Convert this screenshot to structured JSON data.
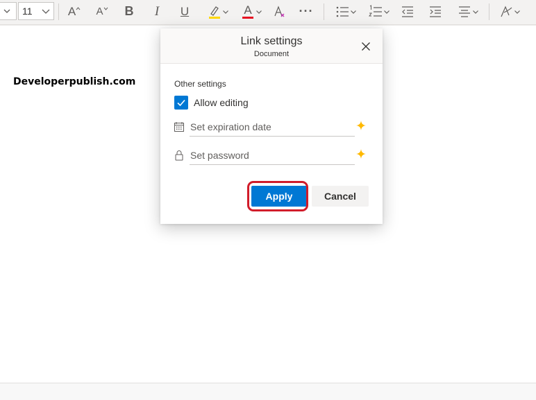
{
  "toolbar": {
    "font_size": "11",
    "buttons": {
      "increase_font": "A",
      "decrease_font": "A",
      "bold": "B",
      "italic": "I",
      "underline": "U",
      "font_color": "A",
      "more": "···"
    },
    "highlight_color": "#ffd800",
    "font_color_swatch": "#e81123"
  },
  "document": {
    "text": "Developerpublish.com"
  },
  "dialog": {
    "title": "Link settings",
    "subtitle": "Document",
    "section_label": "Other settings",
    "allow_editing": {
      "label": "Allow editing",
      "checked": true
    },
    "expiration": {
      "placeholder": "Set expiration date",
      "value": ""
    },
    "password": {
      "placeholder": "Set password",
      "value": ""
    },
    "apply_label": "Apply",
    "cancel_label": "Cancel"
  },
  "colors": {
    "accent": "#0078d4",
    "premium_icon": "#ffb900",
    "highlight_ring": "#d11c2a"
  }
}
